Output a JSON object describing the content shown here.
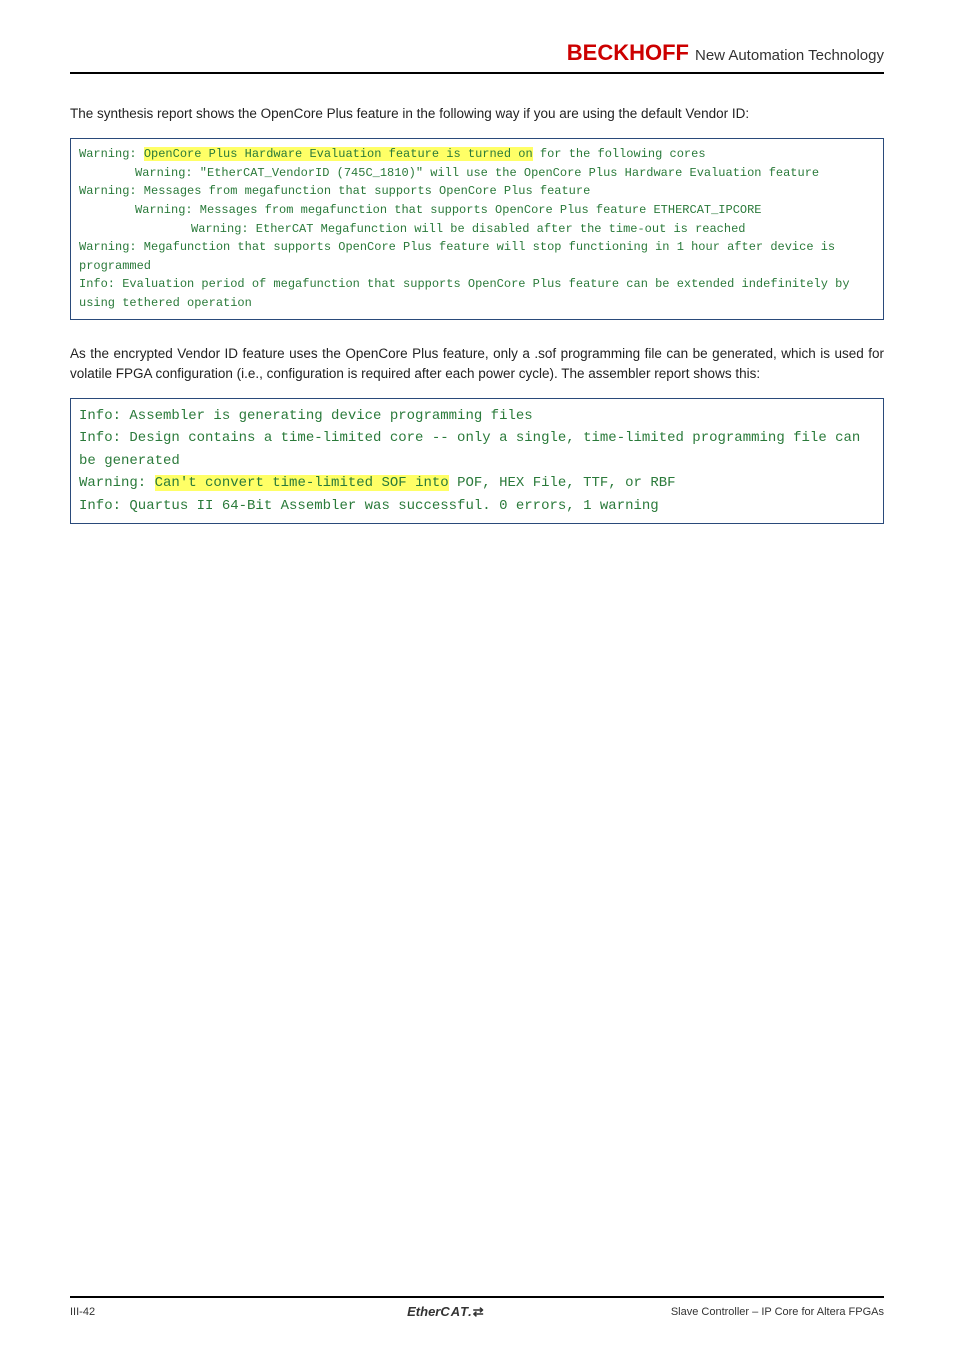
{
  "header": {
    "brand": "BECKHOFF",
    "tagline": "New Automation Technology"
  },
  "intro1": "The synthesis report shows the OpenCore Plus feature in the following way if you are using the default Vendor ID:",
  "codebox1": {
    "l1a": "Warning: ",
    "l1b": "OpenCore Plus Hardware Evaluation feature is turned on",
    "l1c": " for the following cores",
    "l2": "Warning: \"EtherCAT_VendorID (745C_1810)\" will use the OpenCore Plus Hardware Evaluation feature",
    "l3": "Warning: Messages from megafunction that supports OpenCore Plus feature",
    "l4": "Warning: Messages from megafunction that supports OpenCore Plus feature ETHERCAT_IPCORE",
    "l5": "Warning: EtherCAT Megafunction will be disabled after the time-out is reached",
    "l6": "Warning: Megafunction that supports OpenCore Plus feature will stop functioning in 1 hour after device is programmed",
    "l7": "Info: Evaluation period of megafunction that supports OpenCore Plus feature can be extended indefinitely by using tethered operation"
  },
  "intro2": "As the encrypted Vendor ID feature uses the OpenCore Plus feature, only a .sof programming file can be generated, which is used for volatile FPGA configuration (i.e., configuration is required after each power cycle). The assembler report shows this:",
  "codebox2": {
    "l1": "Info: Assembler is generating device programming files",
    "l2": "Info: Design contains a time-limited core -- only a single, time-limited programming file can be generated",
    "l3a": "Warning: ",
    "l3b": "Can't convert time-limited SOF into",
    "l3c": " POF, HEX File, TTF, or RBF",
    "l4": "Info: Quartus II 64-Bit Assembler was successful. 0 errors, 1 warning"
  },
  "footer": {
    "left": "III-42",
    "center_a": "Ether",
    "center_b": "CAT.",
    "right": "Slave Controller – IP Core for Altera FPGAs"
  }
}
